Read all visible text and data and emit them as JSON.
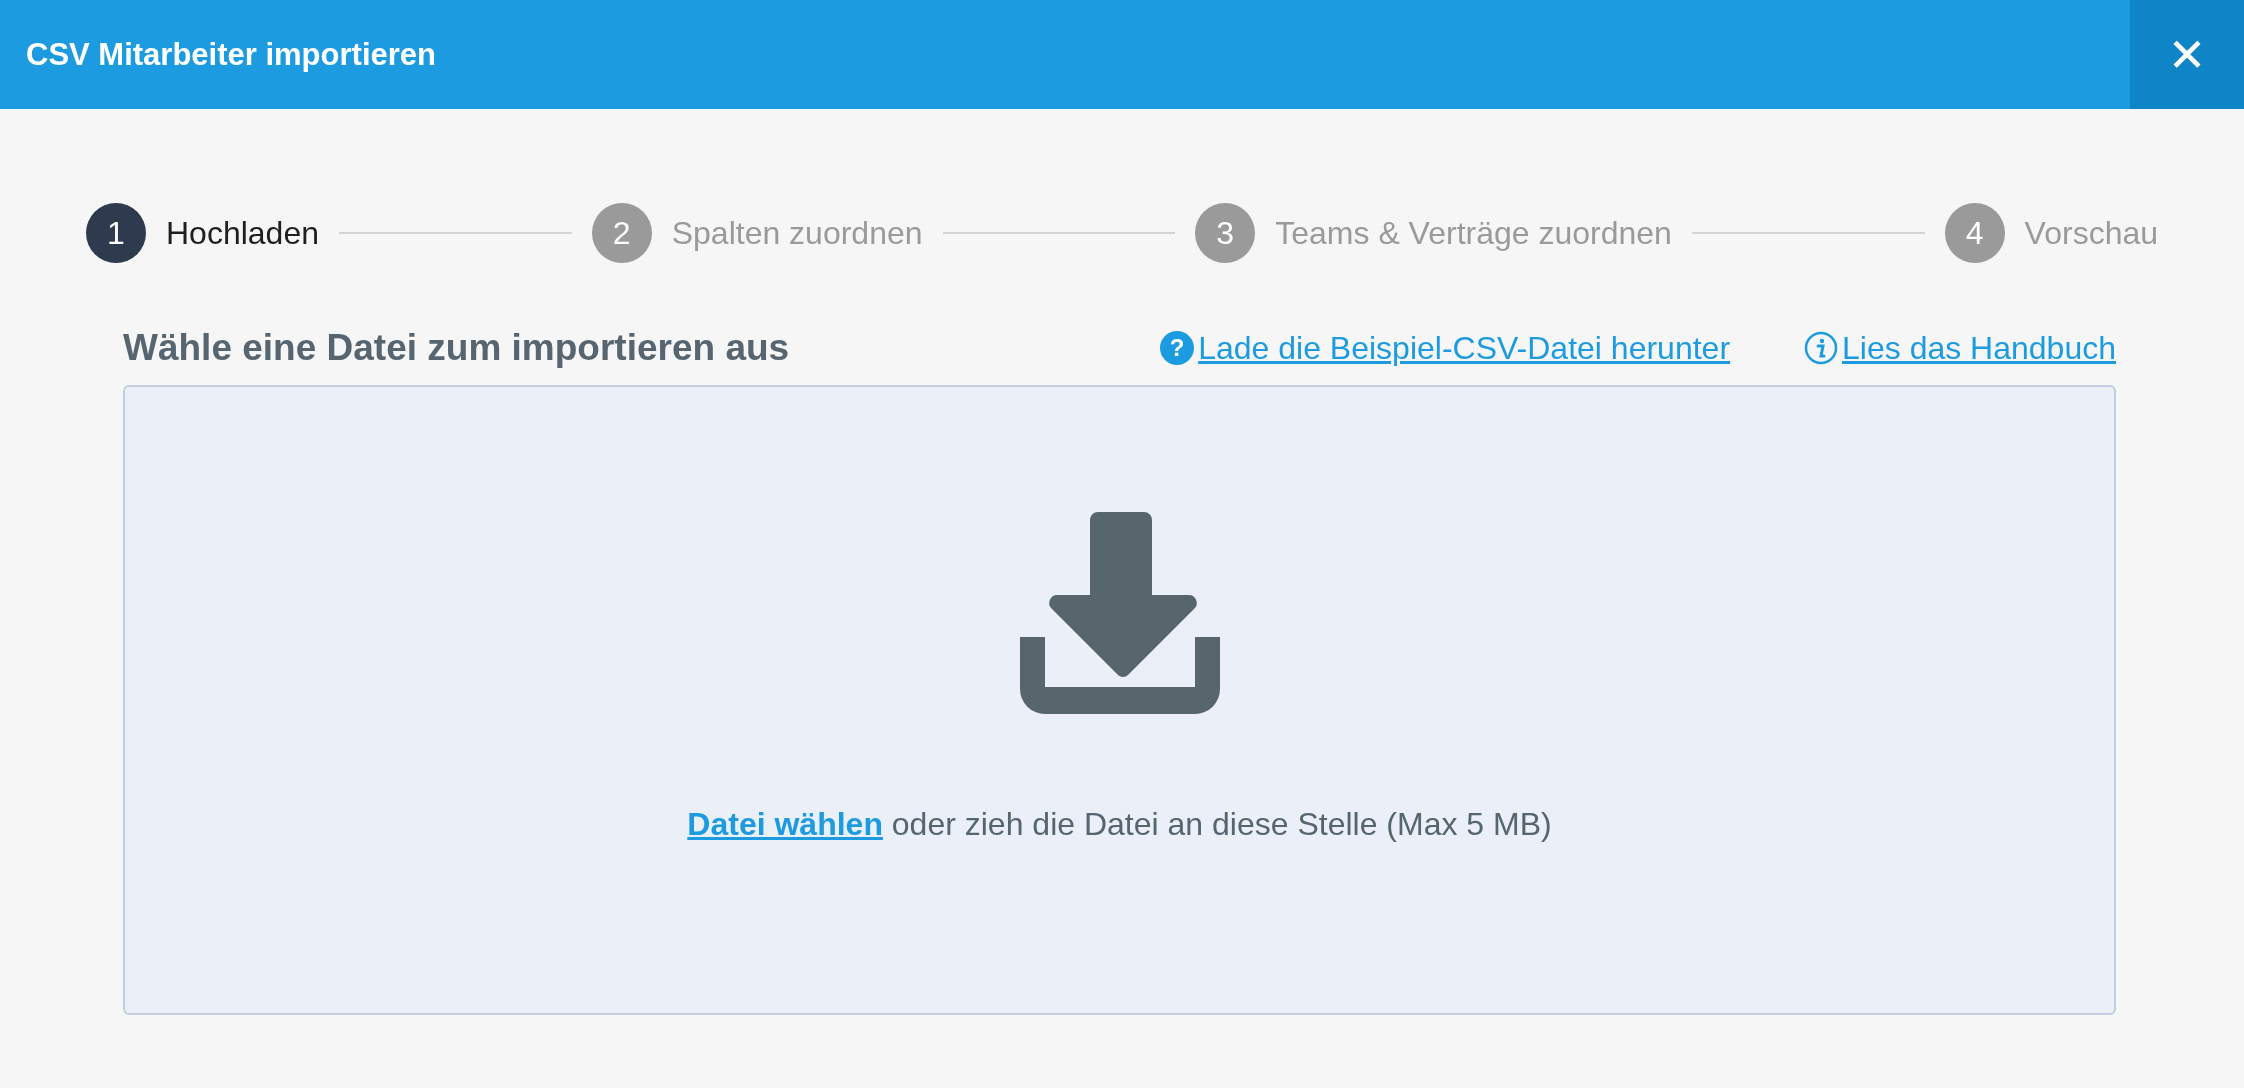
{
  "window": {
    "title": "CSV Mitarbeiter importieren",
    "close": "✕"
  },
  "steps": [
    {
      "number": "1",
      "label": "Hochladen",
      "selected": true
    },
    {
      "number": "2",
      "label": "Spalten zuordnen",
      "selected": false
    },
    {
      "number": "3",
      "label": "Teams & Verträge zuordnen",
      "selected": false
    },
    {
      "number": "4",
      "label": "Vorschau",
      "selected": false
    }
  ],
  "heading": "Wähle eine Datei zum importieren aus",
  "links": [
    {
      "kind": "help",
      "icon": "?",
      "label": "Lade die Beispiel-CSV-Datei herunter"
    },
    {
      "kind": "info",
      "label": "Lies das Handbuch"
    }
  ],
  "dropzone": {
    "link": "Datei wählen",
    "text": "oder zieh die Datei an diese Stelle (Max 5 MB)"
  }
}
